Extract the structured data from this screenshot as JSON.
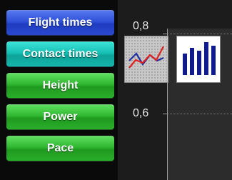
{
  "sidebar": {
    "buttons": [
      {
        "label": "Flight times"
      },
      {
        "label": "Contact times"
      },
      {
        "label": "Height"
      },
      {
        "label": "Power"
      },
      {
        "label": "Pace"
      }
    ]
  },
  "plot": {
    "y_ticks": [
      "0,8",
      "0,6"
    ]
  },
  "chart_type_buttons": [
    {
      "icon": "line-chart-icon"
    },
    {
      "icon": "bar-chart-icon"
    }
  ],
  "colors": {
    "blue_button": "#2f50d8",
    "teal_button": "#16bfb4",
    "green_button": "#2fb62f",
    "line_red": "#e02020",
    "line_blue": "#1f2fa0",
    "bar_navy": "#111a8a"
  }
}
